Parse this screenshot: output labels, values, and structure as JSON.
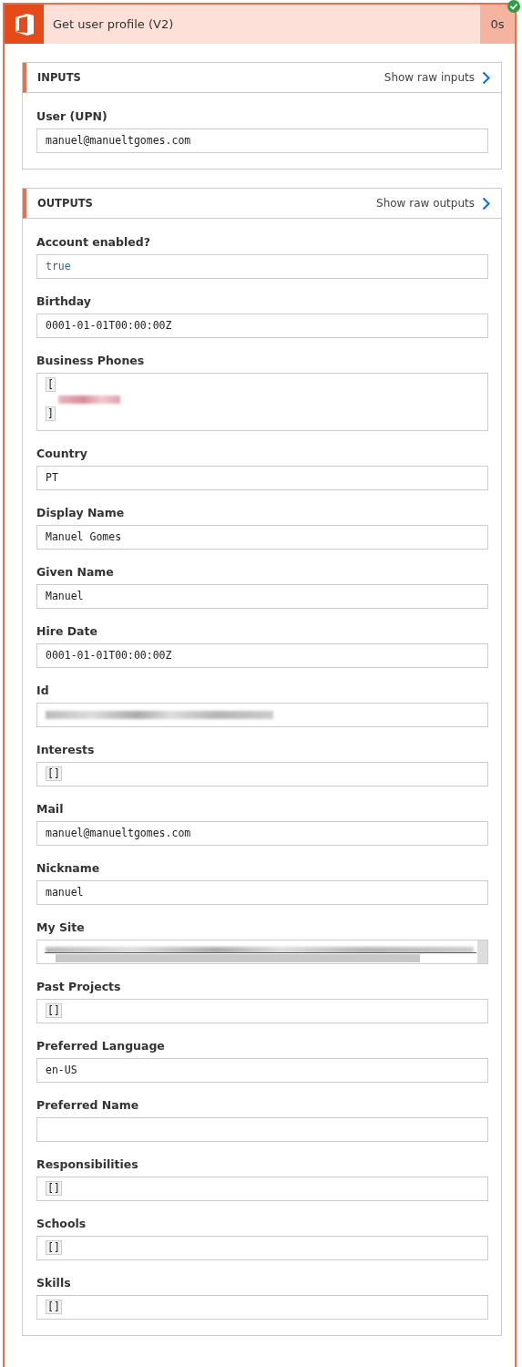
{
  "action": {
    "title": "Get user profile (V2)",
    "duration": "0s",
    "succeeded": true
  },
  "inputs": {
    "heading": "INPUTS",
    "raw_link": "Show raw inputs",
    "fields": [
      {
        "label": "User (UPN)",
        "kind": "text",
        "value": "manuel@manueltgomes.com"
      }
    ]
  },
  "outputs": {
    "heading": "OUTPUTS",
    "raw_link": "Show raw outputs",
    "fields": [
      {
        "label": "Account enabled?",
        "kind": "boolean",
        "value": "true"
      },
      {
        "label": "Birthday",
        "kind": "text",
        "value": "0001-01-01T00:00:00Z"
      },
      {
        "label": "Business Phones",
        "kind": "array",
        "open": "[",
        "close": "]"
      },
      {
        "label": "Country",
        "kind": "text",
        "value": "PT"
      },
      {
        "label": "Display Name",
        "kind": "text",
        "value": "Manuel Gomes"
      },
      {
        "label": "Given Name",
        "kind": "text",
        "value": "Manuel"
      },
      {
        "label": "Hire Date",
        "kind": "text",
        "value": "0001-01-01T00:00:00Z"
      },
      {
        "label": "Id",
        "kind": "redacted"
      },
      {
        "label": "Interests",
        "kind": "empty_array",
        "value": "[]"
      },
      {
        "label": "Mail",
        "kind": "text",
        "value": "manuel@manueltgomes.com"
      },
      {
        "label": "Nickname",
        "kind": "text",
        "value": "manuel"
      },
      {
        "label": "My Site",
        "kind": "scroll"
      },
      {
        "label": "Past Projects",
        "kind": "empty_array",
        "value": "[]"
      },
      {
        "label": "Preferred Language",
        "kind": "text",
        "value": "en-US"
      },
      {
        "label": "Preferred Name",
        "kind": "empty"
      },
      {
        "label": "Responsibilities",
        "kind": "empty_array",
        "value": "[]"
      },
      {
        "label": "Schools",
        "kind": "empty_array",
        "value": "[]"
      },
      {
        "label": "Skills",
        "kind": "empty_array",
        "value": "[]"
      }
    ]
  }
}
